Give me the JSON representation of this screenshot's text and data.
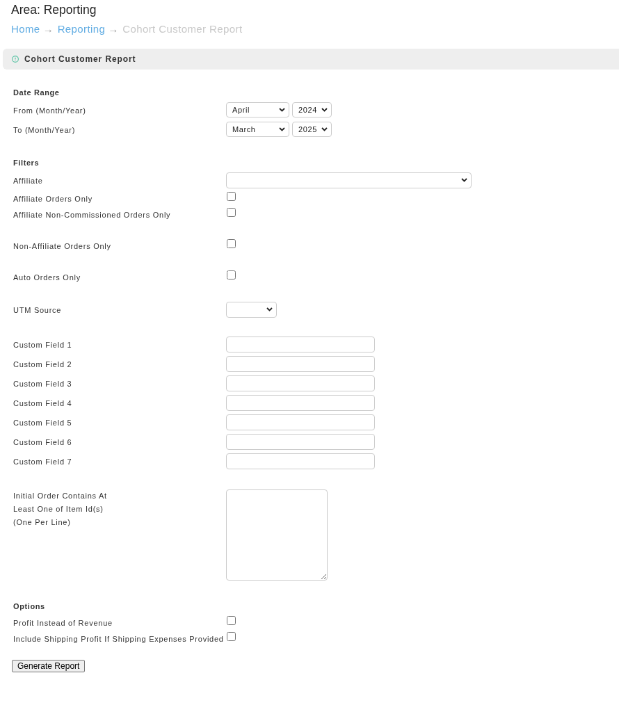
{
  "header": {
    "title": "Area: Reporting"
  },
  "breadcrumb": [
    {
      "label": "Home",
      "kind": "link",
      "separator": "→"
    },
    {
      "label": "Reporting",
      "kind": "link",
      "separator": "→"
    },
    {
      "label": "Cohort Customer Report",
      "kind": "current"
    }
  ],
  "panel": {
    "title": "Cohort Customer Report"
  },
  "sections": [
    {
      "heading": "Date Range",
      "groups": [
        {
          "rows": [
            {
              "label": "From (Month/Year)",
              "kind": "monthyear",
              "month": "April",
              "year": "2024"
            },
            {
              "label": "To (Month/Year)",
              "kind": "monthyear",
              "month": "March",
              "year": "2025"
            }
          ]
        }
      ]
    },
    {
      "heading": "Filters",
      "groups": [
        {
          "rows": [
            {
              "label": "Affiliate",
              "kind": "wideselect"
            },
            {
              "label": "Affiliate Orders Only",
              "kind": "checkbox",
              "checked": false
            },
            {
              "label": "Affiliate Non-Commissioned Orders Only",
              "kind": "checkbox",
              "checked": false
            }
          ]
        },
        {
          "rows": [
            {
              "label": "Non-Affiliate Orders Only",
              "kind": "checkbox",
              "checked": false
            }
          ]
        },
        {
          "rows": [
            {
              "label": "Auto Orders Only",
              "kind": "checkbox",
              "checked": false
            }
          ]
        },
        {
          "rows": [
            {
              "label": "UTM Source",
              "kind": "select"
            }
          ]
        },
        {
          "rows": [
            {
              "label": "Custom Field 1",
              "kind": "text"
            },
            {
              "label": "Custom Field 2",
              "kind": "text"
            },
            {
              "label": "Custom Field 3",
              "kind": "text"
            },
            {
              "label": "Custom Field 4",
              "kind": "text"
            },
            {
              "label": "Custom Field 5",
              "kind": "text"
            },
            {
              "label": "Custom Field 6",
              "kind": "text"
            },
            {
              "label": "Custom Field 7",
              "kind": "text"
            }
          ]
        },
        {
          "rows": [
            {
              "label": "Initial Order Contains At\nLeast One of Item Id(s)\n(One Per Line)",
              "kind": "textarea"
            }
          ]
        }
      ]
    },
    {
      "heading": "Options",
      "groups": [
        {
          "rows": [
            {
              "label": "Profit Instead of Revenue",
              "kind": "checkbox",
              "checked": false
            },
            {
              "label": "Include Shipping Profit If Shipping Expenses Provided",
              "kind": "checkbox",
              "checked": false
            }
          ]
        }
      ]
    }
  ],
  "submit": {
    "label": "Generate Report"
  }
}
